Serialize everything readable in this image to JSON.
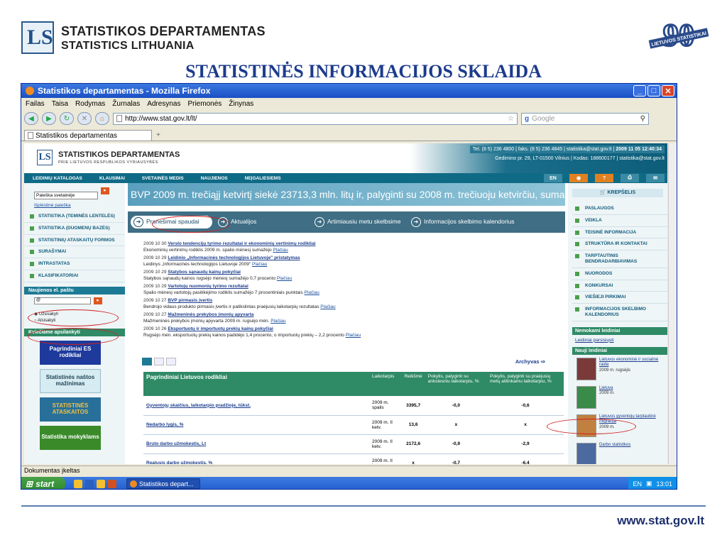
{
  "slide": {
    "brand_line1": "STATISTIKOS DEPARTAMENTAS",
    "brand_line2": "STATISTICS LITHUANIA",
    "badge_number": "90",
    "badge_text": "LIETUVOS STATISTIKAI",
    "title": "STATISTINĖS INFORMACIJOS SKLAIDA",
    "footer_url": "www.stat.gov.lt"
  },
  "browser": {
    "window_title": "Statistikos departamentas - Mozilla Firefox",
    "menu": [
      "Failas",
      "Taisa",
      "Rodymas",
      "Žurnalas",
      "Adresynas",
      "Priemonės",
      "Žinynas"
    ],
    "url": "http://www.stat.gov.lt/lt/",
    "search_placeholder": "Google",
    "tab_title": "Statistikos departamentas",
    "tab_plus": "+",
    "status": "Dokumentas įkeltas"
  },
  "site": {
    "brand": "STATISTIKOS DEPARTAMENTAS",
    "brand_sub": "PRIE LIETUVOS RESPUBLIKOS VYRIAUSYBĖS",
    "phone": "Tel. (8 5) 236 4800",
    "fax": "faks. (8 5) 236 4845",
    "email": "statistika@stat.gov.lt",
    "datetime": "2009 11 05 12:40:34",
    "address": "Gedimino pr. 29, LT-01500 Vilnius",
    "code": "Kodas: 188600177",
    "address_email": "statistika@stat.gov.lt",
    "nav": [
      "LEIDINIŲ KATALOGAS",
      "KLAUSIMAI",
      "SVETAINĖS MEDIS",
      "NAUJIENOS",
      "NEĮGALIESIEMS"
    ],
    "lang_button": "EN",
    "headline": "BVP 2009 m. trečiąjį ketvirtį siekė 23713,3 mln. litų ir, palyginti su 2008 m. trečiuoju ketvirčiu, sumažėjo 14,3"
  },
  "left": {
    "search_select": "Paieška svetainėje",
    "advanced": "Išplėstinė paieška",
    "nav": [
      "STATISTIKA (TEMINĖS LENTELĖS)",
      "STATISTIKA (DUOMENŲ BAZĖS)",
      "STATISTINIŲ ATASKAITŲ FORMOS",
      "SURAŠYMAI",
      "INTRASTATAS",
      "KLASIFIKATORIAI"
    ],
    "email_head": "Naujienos el. paštu",
    "email_value": "@",
    "radio_subscribe": "Užsisakyti",
    "radio_unsubscribe": "Atsisakyti",
    "banners_head": "Kviečiame apsilankyti",
    "banners": [
      "Pagrindiniai ES rodikliai",
      "Statistinės naštos mažinimas",
      "STATISTINĖS ATASKAITOS",
      "Statistika mokyklams"
    ]
  },
  "news": {
    "tabs": [
      "Pranešimai spaudai",
      "Aktualijos",
      "Artimiausiu metu skelbsime",
      "Informacijos skelbimo kalendorius"
    ],
    "more_label": "Plačiau",
    "archive": "Archyvas",
    "items": [
      {
        "date": "2009 10 30",
        "title": "Verslo tendencijų tyrimo rezultatai ir ekonominių vertinimų rodikliai",
        "text": "Ekonominių vertinimų rodiklis 2009 m. spalio mėnesį sumažėjo"
      },
      {
        "date": "2009 10 29",
        "title": "Leidinio „Informacinės technologijos Lietuvoje\" pristatymas",
        "text": "Leidinys „Informacinės technologijos Lietuvoje 2009\""
      },
      {
        "date": "2009 10 29",
        "title": "Statybos sąnaudų kainų pokyčiai",
        "text": "Statybos sąnaudų kainos rugsėjo mėnesį sumažėjo 0,7 procento"
      },
      {
        "date": "2009 10 29",
        "title": "Vartotojų nuomonių tyrimo rezultatai",
        "text": "Spalio mėnesį vartotojų pasitikėjimo rodiklis sumažėjo 7 procentiniais punktais"
      },
      {
        "date": "2009 10 27",
        "title": "BVP pirmasis įvertis",
        "text": "Bendrojo vidaus produkto pirmasis įvertis ir patikslintas praėjusių laikotarpių rezultatas"
      },
      {
        "date": "2009 10 27",
        "title": "Mažmeninės prekybos įmonių apyvarta",
        "text": "Mažmeninės prekybos įmonių apyvarta 2009 m. rugsėjo mėn."
      },
      {
        "date": "2009 10 26",
        "title": "Eksportuotų ir importuotų prekių kainų pokyčiai",
        "text": "Rugsėjo mėn. eksportuotų prekių kainos padidėjo 1,4 procento, o importuotų prekių – 2,2 procento"
      }
    ]
  },
  "indicators": {
    "headers": [
      "Pagrindiniai Lietuvos rodikliai",
      "Laikotarpis",
      "Reikšmė",
      "Pokytis, palyginti su ankstesniu laikotarpiu, %",
      "Pokytis, palyginti su praėjusių metų atitinkamu laikotarpiu, %"
    ],
    "rows": [
      [
        "Gyventojų skaičius, laikotarpio pradžioje, tūkst.",
        "2009 m. spalis",
        "3395,7",
        "-0,0",
        "-0,6"
      ],
      [
        "Nedarbo lygis, %",
        "2009 m. II ketv.",
        "13,6",
        "x",
        "x"
      ],
      [
        "Bruto darbo užmokestis, Lt",
        "2009 m. II ketv.",
        "2172,6",
        "-0,9",
        "-2,9"
      ],
      [
        "Realusis darbo užmokestis, %",
        "2009 m. II ketv.",
        "x",
        "-0,7",
        "-6,4"
      ]
    ]
  },
  "right": {
    "cart": "KREPŠELIS",
    "nav": [
      "PASLAUGOS",
      "VEIKLA",
      "TEISINĖ INFORMACIJA",
      "STRUKTŪRA IR KONTAKTAI",
      "TARPTAUTINIS BENDRADARBIAVIMAS",
      "NUORODOS",
      "KONKURSAI",
      "VIEŠIEJI PIRKIMAI",
      "INFORMACIJOS SKELBIMO KALENDORIUS"
    ],
    "free_head": "Nemokami leidiniai",
    "free_link": "Leidiniai parsisiųsti",
    "new_head": "Nauji leidiniai",
    "pubs": [
      {
        "title": "Lietuvos ekonominė ir socialinė raida",
        "date": "2009 m. rugsėjis",
        "color": "#7a3a3a"
      },
      {
        "title": "Lietuva",
        "date": "2009 m.",
        "color": "#3a8a4a"
      },
      {
        "title": "Lietuvos gyventojų tarptautinė migracija",
        "date": "2009 m.",
        "color": "#c08040"
      },
      {
        "title": "Darbo statistikos",
        "date": "",
        "color": "#4a6aa0"
      }
    ]
  },
  "taskbar": {
    "start": "start",
    "task": "Statistikos depart...",
    "lang": "EN",
    "time": "13:01"
  }
}
